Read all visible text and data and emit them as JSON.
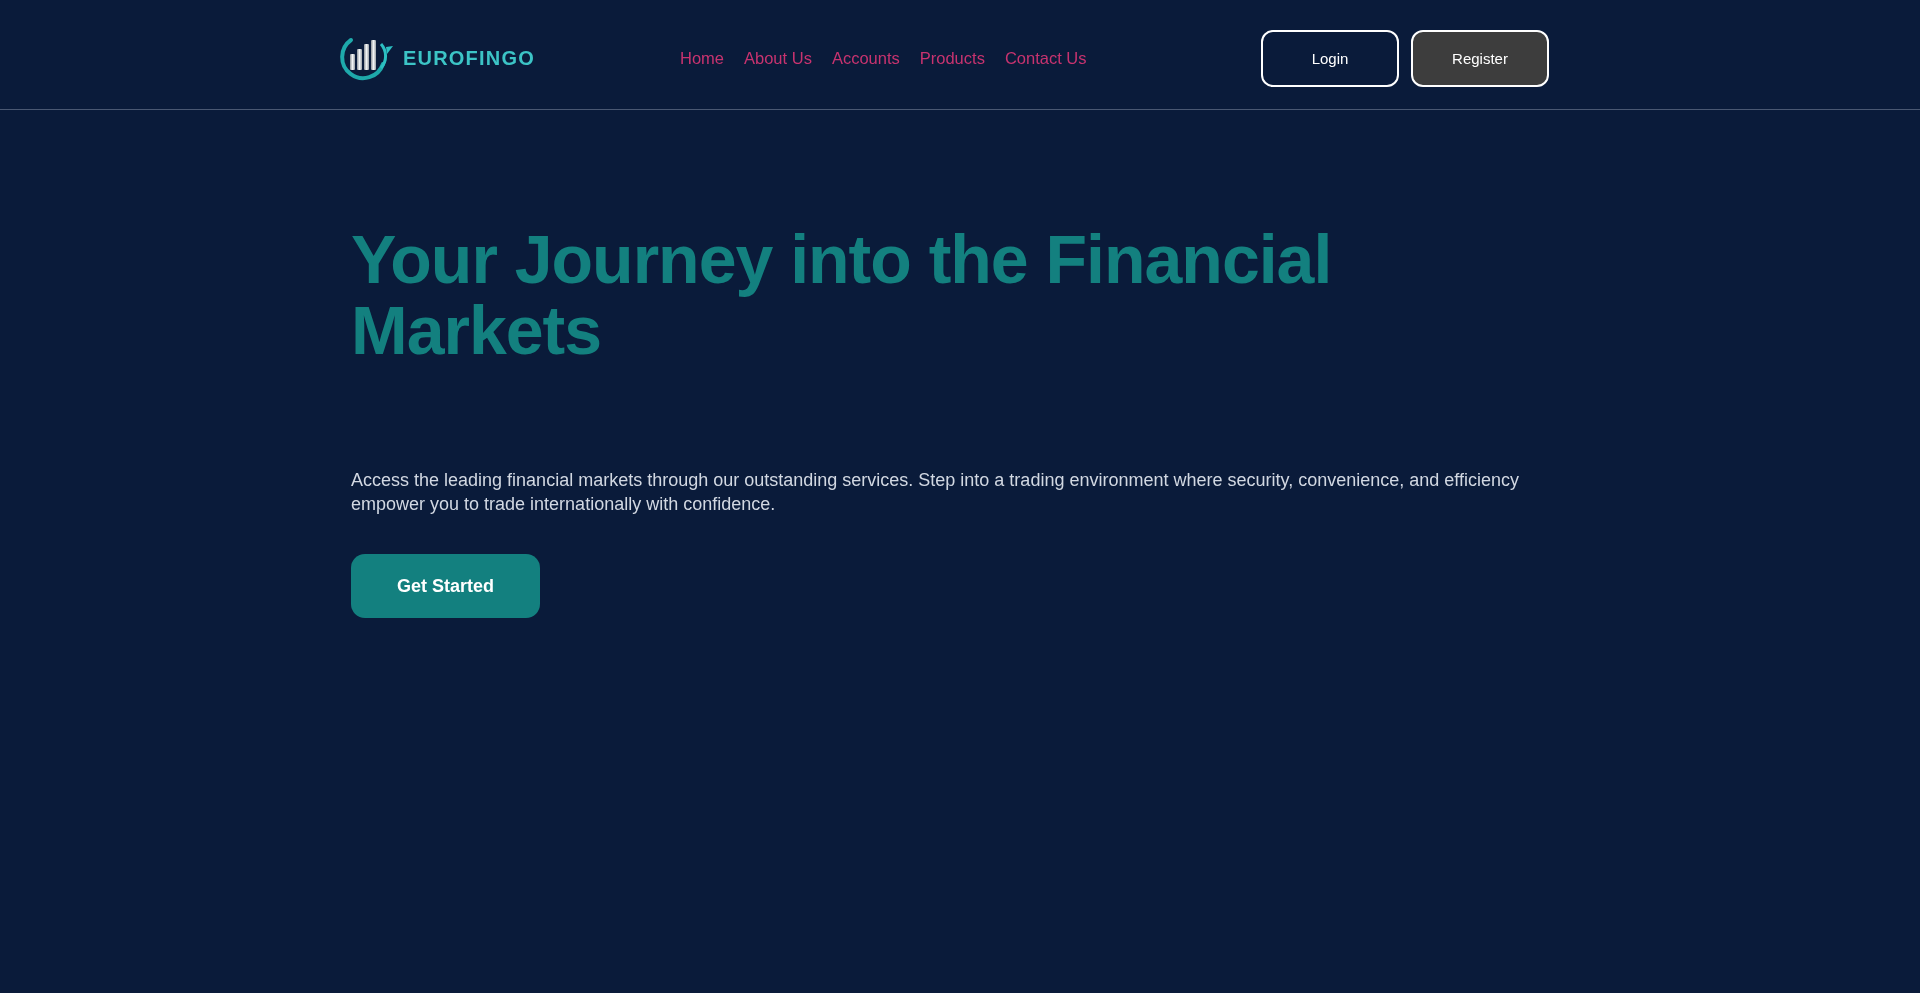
{
  "header": {
    "logo": {
      "text": "EUROFINGO"
    },
    "nav": [
      {
        "label": "Home"
      },
      {
        "label": "About Us"
      },
      {
        "label": "Accounts"
      },
      {
        "label": "Products"
      },
      {
        "label": "Contact Us"
      }
    ],
    "buttons": [
      {
        "label": "Login",
        "kind": "outline"
      },
      {
        "label": "Register",
        "kind": "filled"
      }
    ]
  },
  "hero": {
    "title": "Your Journey into the Financial Markets",
    "description": "Access the leading financial markets through our outstanding services. Step into a trading environment where security, convenience, and efficiency empower you to trade internationally with confidence.",
    "cta": "Get Started"
  }
}
